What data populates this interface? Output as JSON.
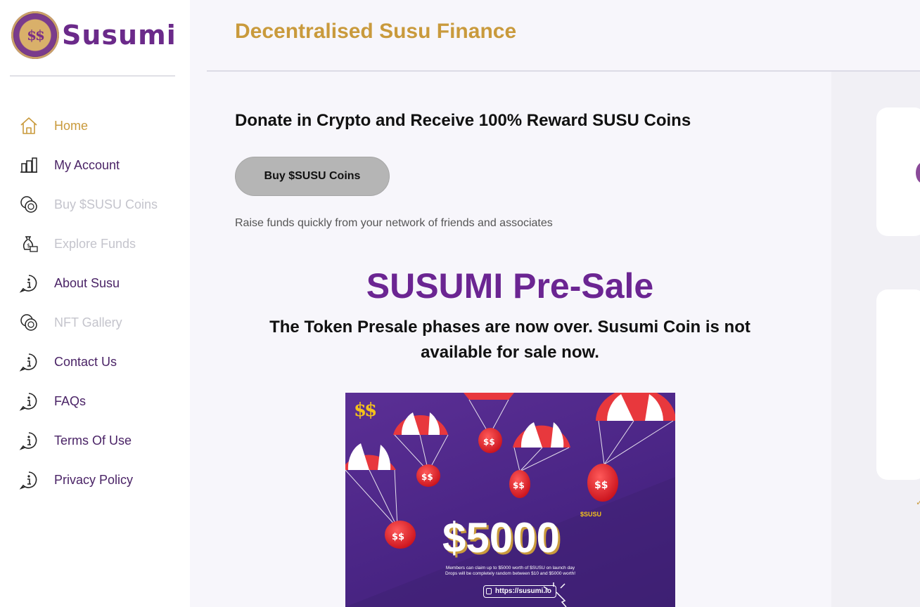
{
  "brand": {
    "logo_text": "$$",
    "name": "Susumi"
  },
  "sidebar": {
    "items": [
      {
        "label": "Home",
        "icon": "home-icon",
        "state": "active"
      },
      {
        "label": "My Account",
        "icon": "account-icon",
        "state": "normal"
      },
      {
        "label": "Buy $SUSU Coins",
        "icon": "coins-icon",
        "state": "muted"
      },
      {
        "label": "Explore Funds",
        "icon": "funds-icon",
        "state": "muted"
      },
      {
        "label": "About Susu",
        "icon": "info-icon",
        "state": "normal"
      },
      {
        "label": "NFT Gallery",
        "icon": "coins-icon",
        "state": "muted"
      },
      {
        "label": "Contact Us",
        "icon": "info-icon",
        "state": "normal"
      },
      {
        "label": "FAQs",
        "icon": "info-icon",
        "state": "normal"
      },
      {
        "label": "Terms Of Use",
        "icon": "info-icon",
        "state": "normal"
      },
      {
        "label": "Privacy Policy",
        "icon": "info-icon",
        "state": "normal"
      }
    ]
  },
  "header": {
    "title": "Decentralised Susu Finance"
  },
  "main": {
    "donate_title": "Donate in Crypto and Receive 100% Reward SUSU Coins",
    "buy_button": "Buy $SUSU Coins",
    "raise_text": "Raise funds quickly from your network of friends and associates",
    "presale_title": "SUSUMI Pre-Sale",
    "presale_message": "The Token Presale phases are now over. Susumi Coin is not available for sale now."
  },
  "promo": {
    "logo": "$$",
    "amount": "$5000",
    "currency": "$SUSU",
    "line1": "Members can claim up to $5000 worth of $SUSU on launch day",
    "line2": "Drops will be completely random between $10 and $5000 worth!",
    "url": "https://susumi.io"
  },
  "colors": {
    "accent_gold": "#c99a3c",
    "brand_purple": "#6b2592",
    "nav_text": "#4a2366",
    "muted_text": "#c4c4cc"
  }
}
